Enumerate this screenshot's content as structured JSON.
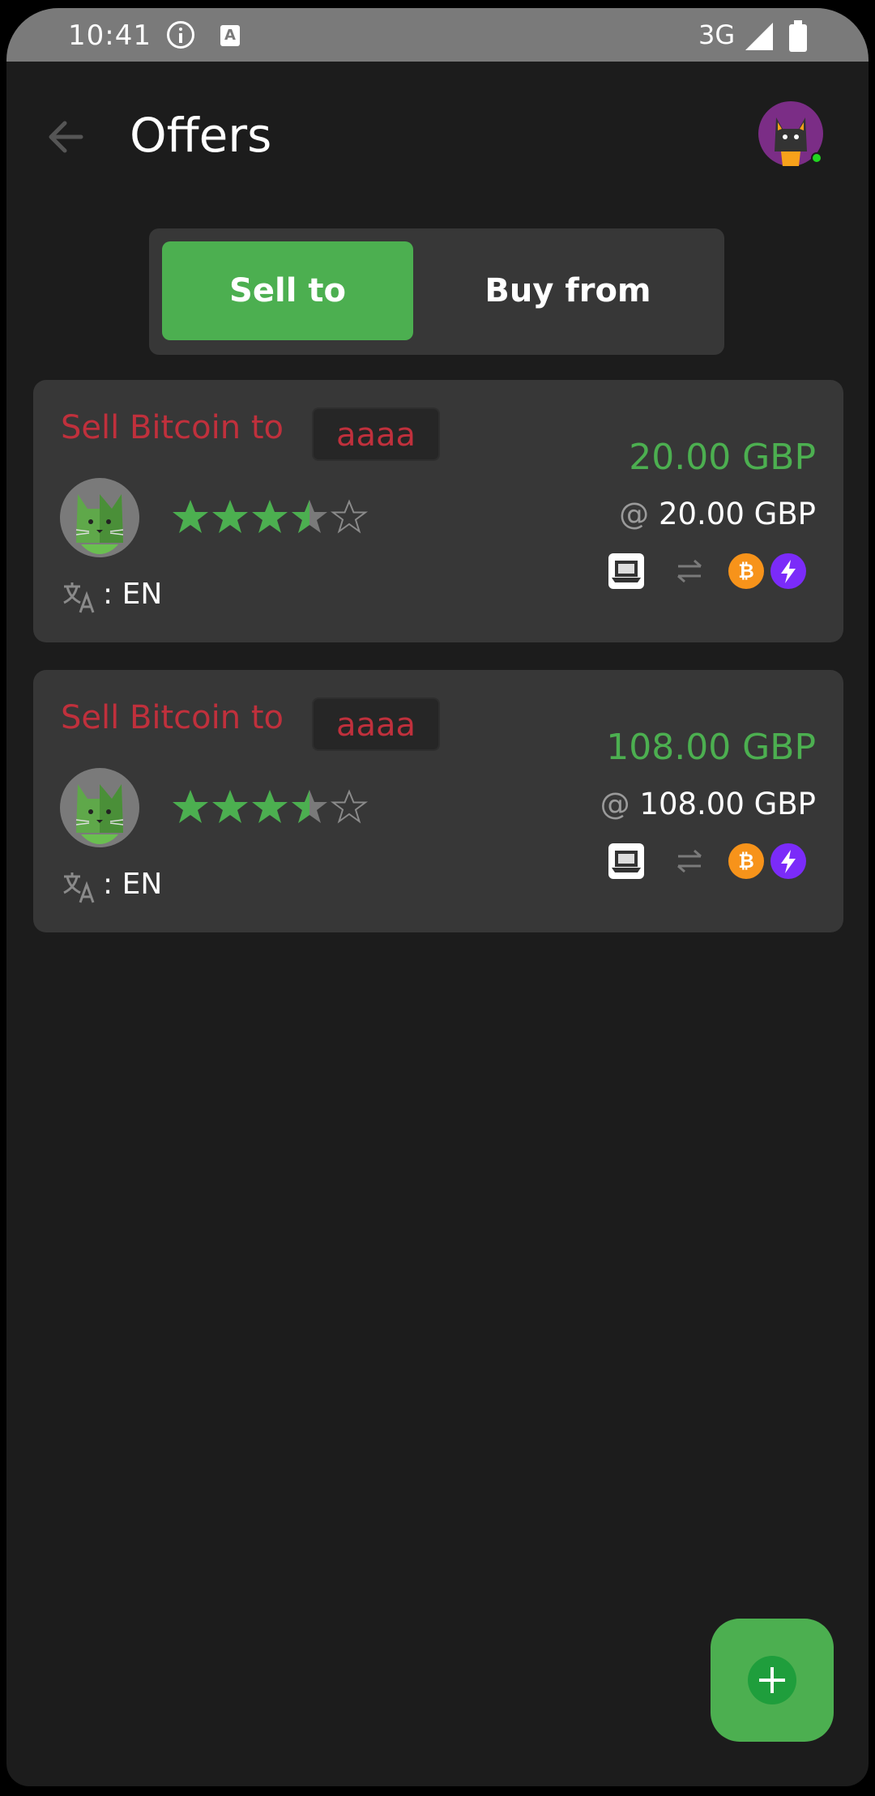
{
  "status_bar": {
    "time": "10:41",
    "network": "3G",
    "icons": [
      "info-icon",
      "keyboard-a-icon",
      "signal-icon",
      "battery-icon"
    ]
  },
  "header": {
    "title": "Offers",
    "back_icon": "arrow-left-icon",
    "avatar_icon": "cat-avatar-icon",
    "online_color": "#21d621"
  },
  "tabs": [
    {
      "label": "Sell to",
      "active": true
    },
    {
      "label": "Buy from",
      "active": false
    }
  ],
  "offers": [
    {
      "heading": "Sell Bitcoin to",
      "username": "aaaa",
      "rating_stars": 3.5,
      "language_separator": ":",
      "language": "EN",
      "amount": "20.00 GBP",
      "price_prefix": "@",
      "price": "20.00 GBP",
      "payment_icons": [
        "bank-transfer-icon",
        "swap-arrows-icon",
        "bitcoin-icon",
        "lightning-icon"
      ]
    },
    {
      "heading": "Sell Bitcoin to",
      "username": "aaaa",
      "rating_stars": 3.5,
      "language_separator": ":",
      "language": "EN",
      "amount": "108.00 GBP",
      "price_prefix": "@",
      "price": "108.00 GBP",
      "payment_icons": [
        "bank-transfer-icon",
        "swap-arrows-icon",
        "bitcoin-icon",
        "lightning-icon"
      ]
    }
  ],
  "fab": {
    "icon": "plus-icon"
  },
  "colors": {
    "background": "#1c1c1c",
    "card": "#373737",
    "accent_green": "#4caf50",
    "sell_red": "#c0303c",
    "bitcoin_orange": "#f7931a",
    "lightning_purple": "#7b2bf9"
  }
}
